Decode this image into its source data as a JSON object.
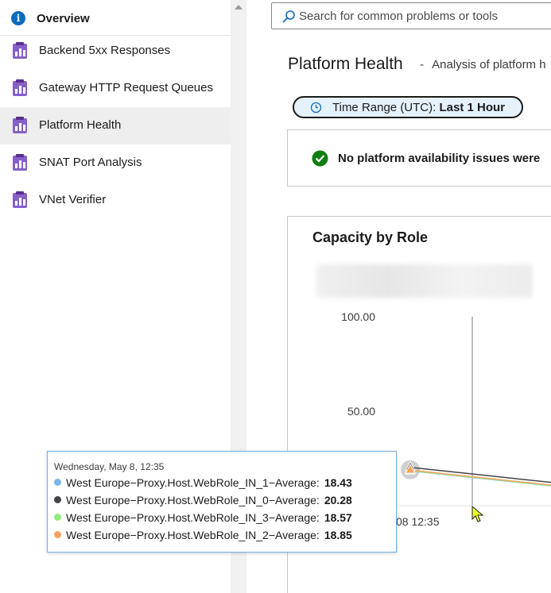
{
  "sidebar": {
    "overview_label": "Overview",
    "items": [
      {
        "label": "Backend 5xx Responses",
        "icon": "detector-icon"
      },
      {
        "label": "Gateway HTTP Request Queues",
        "icon": "detector-icon"
      },
      {
        "label": "Platform Health",
        "icon": "detector-icon",
        "selected": true
      },
      {
        "label": "SNAT Port Analysis",
        "icon": "detector-icon"
      },
      {
        "label": "VNet Verifier",
        "icon": "detector-icon"
      }
    ]
  },
  "search": {
    "placeholder": "Search for common problems or tools"
  },
  "header": {
    "title": "Platform Health",
    "separator": "-",
    "subtitle": "Analysis of platform h"
  },
  "time_range": {
    "label": "Time Range (UTC):",
    "value": "Last 1 Hour"
  },
  "status": {
    "text": "No platform availability issues were",
    "icon": "check-icon",
    "color": "#107c10"
  },
  "chart": {
    "title": "Capacity by Role",
    "x_tick": "08 12:35"
  },
  "chart_data": {
    "type": "line",
    "title": "Capacity by Role",
    "ylim": [
      0,
      100
    ],
    "y_ticks": [
      "100.00",
      "50.00"
    ],
    "x_ticks": [
      "08 12:35"
    ],
    "series": [
      {
        "name": "West Europe-Proxy.Host.WebRole_IN_1-Average",
        "color": "#7cb5ec",
        "values": [
          18.43
        ]
      },
      {
        "name": "West Europe-Proxy.Host.WebRole_IN_0-Average",
        "color": "#434348",
        "values": [
          20.28
        ]
      },
      {
        "name": "West Europe-Proxy.Host.WebRole_IN_3-Average",
        "color": "#90ed7d",
        "values": [
          18.57
        ]
      },
      {
        "name": "West Europe-Proxy.Host.WebRole_IN_2-Average",
        "color": "#f7a35c",
        "values": [
          18.85
        ]
      }
    ]
  },
  "tooltip": {
    "date": "Wednesday, May 8, 12:35",
    "rows": [
      {
        "name": "West Europe−Proxy.Host.WebRole_IN_1−Average:",
        "value": "18.43",
        "color": "#7cb5ec"
      },
      {
        "name": "West Europe−Proxy.Host.WebRole_IN_0−Average:",
        "value": "20.28",
        "color": "#434348"
      },
      {
        "name": "West Europe−Proxy.Host.WebRole_IN_3−Average:",
        "value": "18.57",
        "color": "#90ed7d"
      },
      {
        "name": "West Europe−Proxy.Host.WebRole_IN_2−Average:",
        "value": "18.85",
        "color": "#f7a35c"
      }
    ]
  }
}
